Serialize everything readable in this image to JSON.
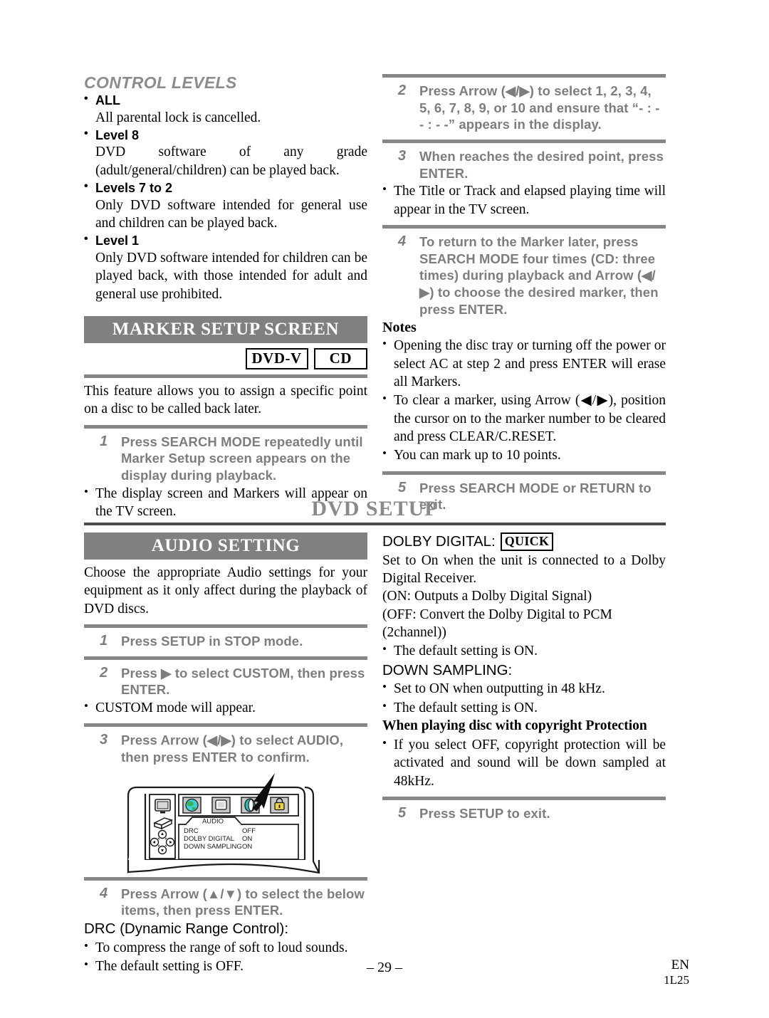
{
  "left_column": {
    "control_levels": {
      "title": "CONTROL LEVELS",
      "entries": [
        {
          "term": "ALL",
          "desc": "All parental lock is cancelled."
        },
        {
          "term": "Level 8",
          "desc": "DVD software of any grade (adult/general/children) can be played back."
        },
        {
          "term": "Levels 7 to 2",
          "desc": "Only DVD software intended for general use and children can be played back."
        },
        {
          "term": "Level 1",
          "desc": "Only DVD software intended for children can be played back, with those intended for adult and general use prohibited."
        }
      ]
    },
    "marker_setup": {
      "band_title": "MARKER SETUP SCREEN",
      "badges": [
        "DVD-V",
        "CD"
      ],
      "intro": "This feature allows you to assign a specific point on a disc to be called back later.",
      "step1_num": "1",
      "step1_text": "Press SEARCH MODE repeatedly until Marker Setup screen appears on the display during playback.",
      "step1_note": "The display screen and Markers will appear on the TV screen."
    }
  },
  "right_column": {
    "marker_steps": [
      {
        "num": "2",
        "text": "Press Arrow (◀/▶) to select 1, 2, 3, 4, 5, 6, 7, 8, 9, or 10 and ensure that “- : - - : - -” appears in the display."
      },
      {
        "num": "3",
        "text": "When reaches the desired point, press ENTER."
      },
      {
        "num": "4",
        "text": "To return to the Marker later, press SEARCH MODE four times (CD: three times) during playback and Arrow (◀/▶) to choose the desired marker, then press ENTER."
      }
    ],
    "step3_note": "The Title or Track and elapsed playing time will appear in the TV screen.",
    "notes_heading": "Notes",
    "notes": [
      "Opening the disc tray or turning off the power or select AC at step 2 and press ENTER will erase all Markers.",
      "To clear a marker, using Arrow (◀/▶), position the cursor on to the marker number to be cleared and press CLEAR/C.RESET.",
      "You can mark up to 10 points."
    ],
    "step5_num": "5",
    "step5_text": "Press SEARCH MODE or RETURN to exit."
  },
  "section": {
    "title": "DVD SETUP"
  },
  "audio_setting": {
    "band_title": "AUDIO SETTING",
    "intro": "Choose the appropriate Audio settings for your equipment as it only affect during the playback of DVD discs.",
    "steps": [
      {
        "num": "1",
        "text": "Press SETUP in STOP mode."
      },
      {
        "num": "2",
        "text": "Press ▶ to select CUSTOM, then press ENTER."
      },
      {
        "num": "3",
        "text": "Press Arrow (◀/▶) to select AUDIO, then press ENTER to confirm."
      },
      {
        "num": "4",
        "text": "Press Arrow (▲/▼) to select the below items, then press ENTER."
      }
    ],
    "step2_note": "CUSTOM mode will appear.",
    "drc_heading": "DRC (Dynamic Range Control):",
    "drc_notes": [
      "To compress the range of soft to loud sounds.",
      "The default setting is OFF."
    ]
  },
  "osd_illustration": {
    "menu_tab_label": "AUDIO",
    "rows": [
      {
        "label": "DRC",
        "value": "OFF"
      },
      {
        "label": "DOLBY DIGITAL",
        "value": "ON"
      },
      {
        "label": "DOWN SAMPLING",
        "value": "ON"
      }
    ],
    "icons": [
      "globe-language-icon",
      "display-screen-icon",
      "audio-speaker-icon",
      "lock-parental-icon"
    ],
    "side_icons": [
      "tv-monitor-icon",
      "remote-control-icon",
      "dpad-arrows-icon"
    ],
    "pointer": "cursor-arrow-icon",
    "colors": {
      "globe": "#3fd0d8",
      "globe_land": "#3fae5a",
      "speaker": "#2fb8ae",
      "lock": "#e8d44a",
      "icon_bg": "#c7c7c7"
    }
  },
  "dolby": {
    "label": "DOLBY DIGITAL:",
    "quick_badge": "QUICK",
    "desc": "Set to On when the unit is connected to a Dolby Digital Receiver.",
    "on_line": "(ON: Outputs a Dolby Digital Signal)",
    "off_line": "(OFF: Convert the Dolby Digital to PCM (2channel))",
    "default_note": "The default setting is ON.",
    "down_sampling_label": "DOWN SAMPLING:",
    "down_sampling_notes": [
      "Set to ON when outputting in 48 kHz.",
      "The default setting is ON."
    ],
    "copyright_heading": "When playing disc with copyright Protection",
    "copyright_note": "If you select OFF, copyright protection will be activated and sound will be down sampled at 48kHz.",
    "step5_num": "5",
    "step5_text": "Press SETUP to exit."
  },
  "footer": {
    "page_number": "– 29 –",
    "lang": "EN",
    "code": "1L25"
  }
}
